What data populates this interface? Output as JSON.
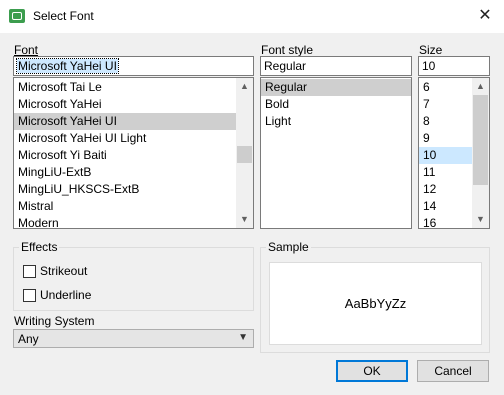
{
  "window": {
    "title": "Select Font",
    "icon": "qt-app-icon",
    "close": "✕"
  },
  "font": {
    "label": "Font",
    "value": "Microsoft YaHei UI",
    "items": [
      "Microsoft Tai Le",
      "Microsoft YaHei",
      "Microsoft YaHei UI",
      "Microsoft YaHei UI Light",
      "Microsoft Yi Baiti",
      "MingLiU-ExtB",
      "MingLiU_HKSCS-ExtB",
      "Mistral",
      "Modern"
    ],
    "selected": "Microsoft YaHei UI"
  },
  "style": {
    "label": "Font style",
    "value": "Regular",
    "items": [
      "Regular",
      "Bold",
      "Light"
    ],
    "selected": "Regular"
  },
  "size": {
    "label": "Size",
    "value": "10",
    "items": [
      "6",
      "7",
      "8",
      "9",
      "10",
      "11",
      "12",
      "14",
      "16"
    ],
    "selected": "10"
  },
  "effects": {
    "label": "Effects",
    "strikeout": "Strikeout",
    "underline": "Underline"
  },
  "writing_system": {
    "label": "Writing System",
    "value": "Any"
  },
  "sample": {
    "label": "Sample",
    "text": "AaBbYyZz"
  },
  "buttons": {
    "ok": "OK",
    "cancel": "Cancel"
  }
}
